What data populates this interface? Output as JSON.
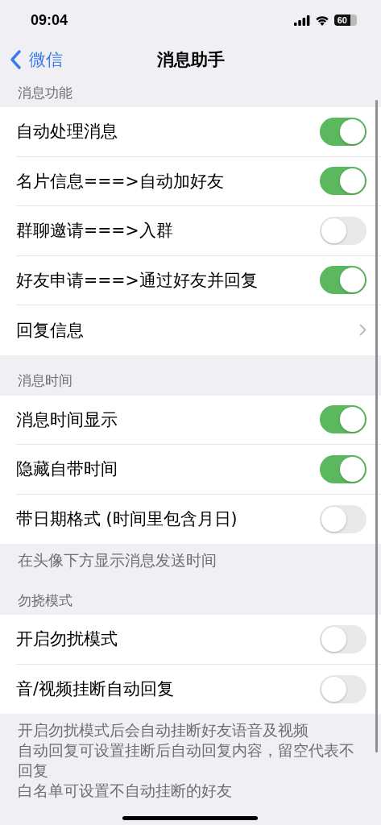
{
  "status_bar": {
    "time": "09:04",
    "battery": "60"
  },
  "nav": {
    "back": "微信",
    "title": "消息助手"
  },
  "sections": [
    {
      "header": "消息功能",
      "rows": [
        {
          "kind": "toggle",
          "label": "自动处理消息",
          "on": true
        },
        {
          "kind": "toggle",
          "label": "名片信息===>自动加好友",
          "on": true
        },
        {
          "kind": "toggle",
          "label": "群聊邀请===>入群",
          "on": false
        },
        {
          "kind": "toggle",
          "label": "好友申请===>通过好友并回复",
          "on": true
        },
        {
          "kind": "link",
          "label": "回复信息"
        }
      ]
    },
    {
      "header": "消息时间",
      "rows": [
        {
          "kind": "toggle",
          "label": "消息时间显示",
          "on": true
        },
        {
          "kind": "toggle",
          "label": "隐藏自带时间",
          "on": true
        },
        {
          "kind": "toggle",
          "label": "带日期格式 (时间里包含月日)",
          "on": false
        }
      ],
      "footer": [
        "在头像下方显示消息发送时间"
      ]
    },
    {
      "header": "勿挠模式",
      "rows": [
        {
          "kind": "toggle",
          "label": "开启勿扰模式",
          "on": false
        },
        {
          "kind": "toggle",
          "label": "音/视频挂断自动回复",
          "on": false
        }
      ],
      "footer": [
        "开启勿扰模式后会自动挂断好友语音及视频",
        "自动回复可设置挂断后自动回复内容，留空代表不回复",
        "白名单可设置不自动挂断的好友"
      ]
    }
  ]
}
